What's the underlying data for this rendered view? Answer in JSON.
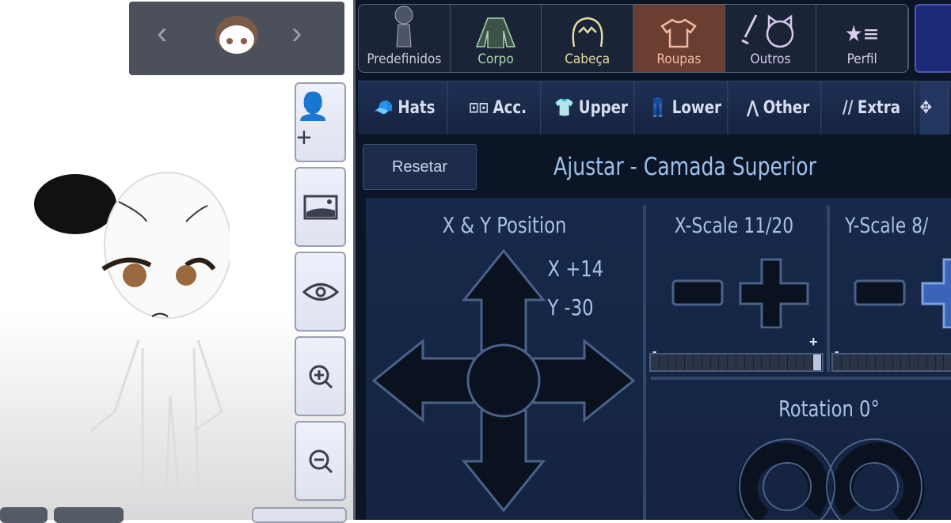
{
  "character_nav": {
    "prev_icon": "chevron-left-icon",
    "next_icon": "chevron-right-icon",
    "avatar": "character-head-avatar"
  },
  "side_buttons": [
    {
      "icon": "add-person-icon"
    },
    {
      "icon": "background-image-icon"
    },
    {
      "icon": "eye-icon"
    },
    {
      "icon": "zoom-in-icon"
    },
    {
      "icon": "zoom-out-icon"
    }
  ],
  "main_tabs": [
    {
      "label": "Predefinidos",
      "color": "#c8ccdc"
    },
    {
      "label": "Corpo",
      "color": "#a8d8b0"
    },
    {
      "label": "Cabeça",
      "color": "#e6dca0"
    },
    {
      "label": "Roupas",
      "color": "#f2b8a0",
      "active": true
    },
    {
      "label": "Outros",
      "color": "#d8c8f0"
    },
    {
      "label": "Perfil",
      "color": "#d8d0f0"
    }
  ],
  "sub_tabs": [
    {
      "label": "Hats",
      "icon": "cap-icon"
    },
    {
      "label": "Acc.",
      "icon": "glasses-icon"
    },
    {
      "label": "Upper",
      "icon": "shirt-icon"
    },
    {
      "label": "Lower",
      "icon": "pants-icon"
    },
    {
      "label": "Other",
      "icon": "cape-icon"
    },
    {
      "label": "Extra",
      "icon": "slashes-icon",
      "prefix": "//"
    },
    {
      "label": "",
      "icon": "move-icon"
    }
  ],
  "reset_label": "Resetar",
  "title": "Ajustar - Camada Superior",
  "position": {
    "title": "X & Y Position",
    "x": "X +14",
    "y": "Y -30"
  },
  "x_scale": {
    "title": "X-Scale 11/20",
    "value": 11,
    "max": 20,
    "minus": "-",
    "plus": "+"
  },
  "y_scale": {
    "title": "Y-Scale 8/",
    "value": 8,
    "max": 20,
    "minus": "-"
  },
  "rotation": {
    "title": "Rotation 0°"
  },
  "colors": {
    "panel": "#0c1526",
    "active_tab": "#6b3e32",
    "accent": "#9cc0ea"
  }
}
